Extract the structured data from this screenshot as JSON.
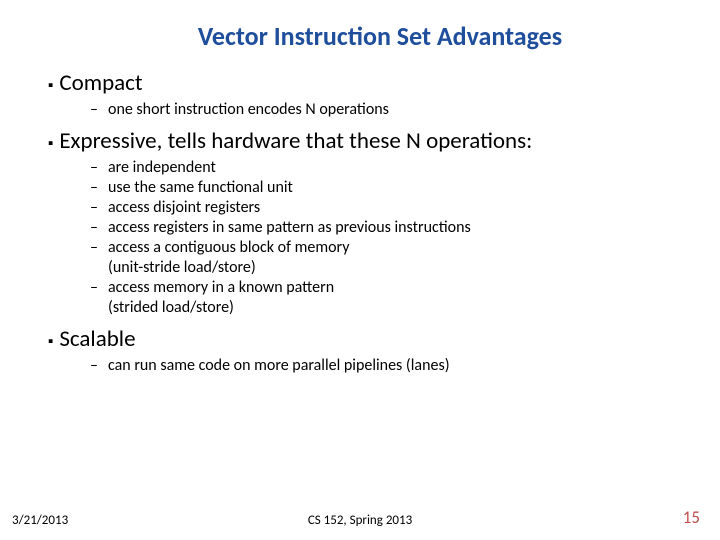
{
  "title": "Vector Instruction Set Advantages",
  "items": {
    "compact": {
      "label": "Compact",
      "sub": [
        {
          "text": "one short instruction encodes N operations"
        }
      ]
    },
    "expressive": {
      "label": "Expressive, tells hardware that these N operations:",
      "sub": [
        {
          "text": "are independent"
        },
        {
          "text": "use the same functional unit"
        },
        {
          "text": "access disjoint registers"
        },
        {
          "text": "access registers in same pattern as previous instructions"
        },
        {
          "text": "access a contiguous block of memory",
          "paren": "(unit-stride load/store)"
        },
        {
          "text": "access memory in a known pattern",
          "paren": "(strided load/store)"
        }
      ]
    },
    "scalable": {
      "label": "Scalable",
      "sub": [
        {
          "text": "can run same code on more parallel pipelines (lanes)"
        }
      ]
    }
  },
  "footer": {
    "date": "3/21/2013",
    "center": "CS 152, Spring 2013",
    "page": "15"
  }
}
